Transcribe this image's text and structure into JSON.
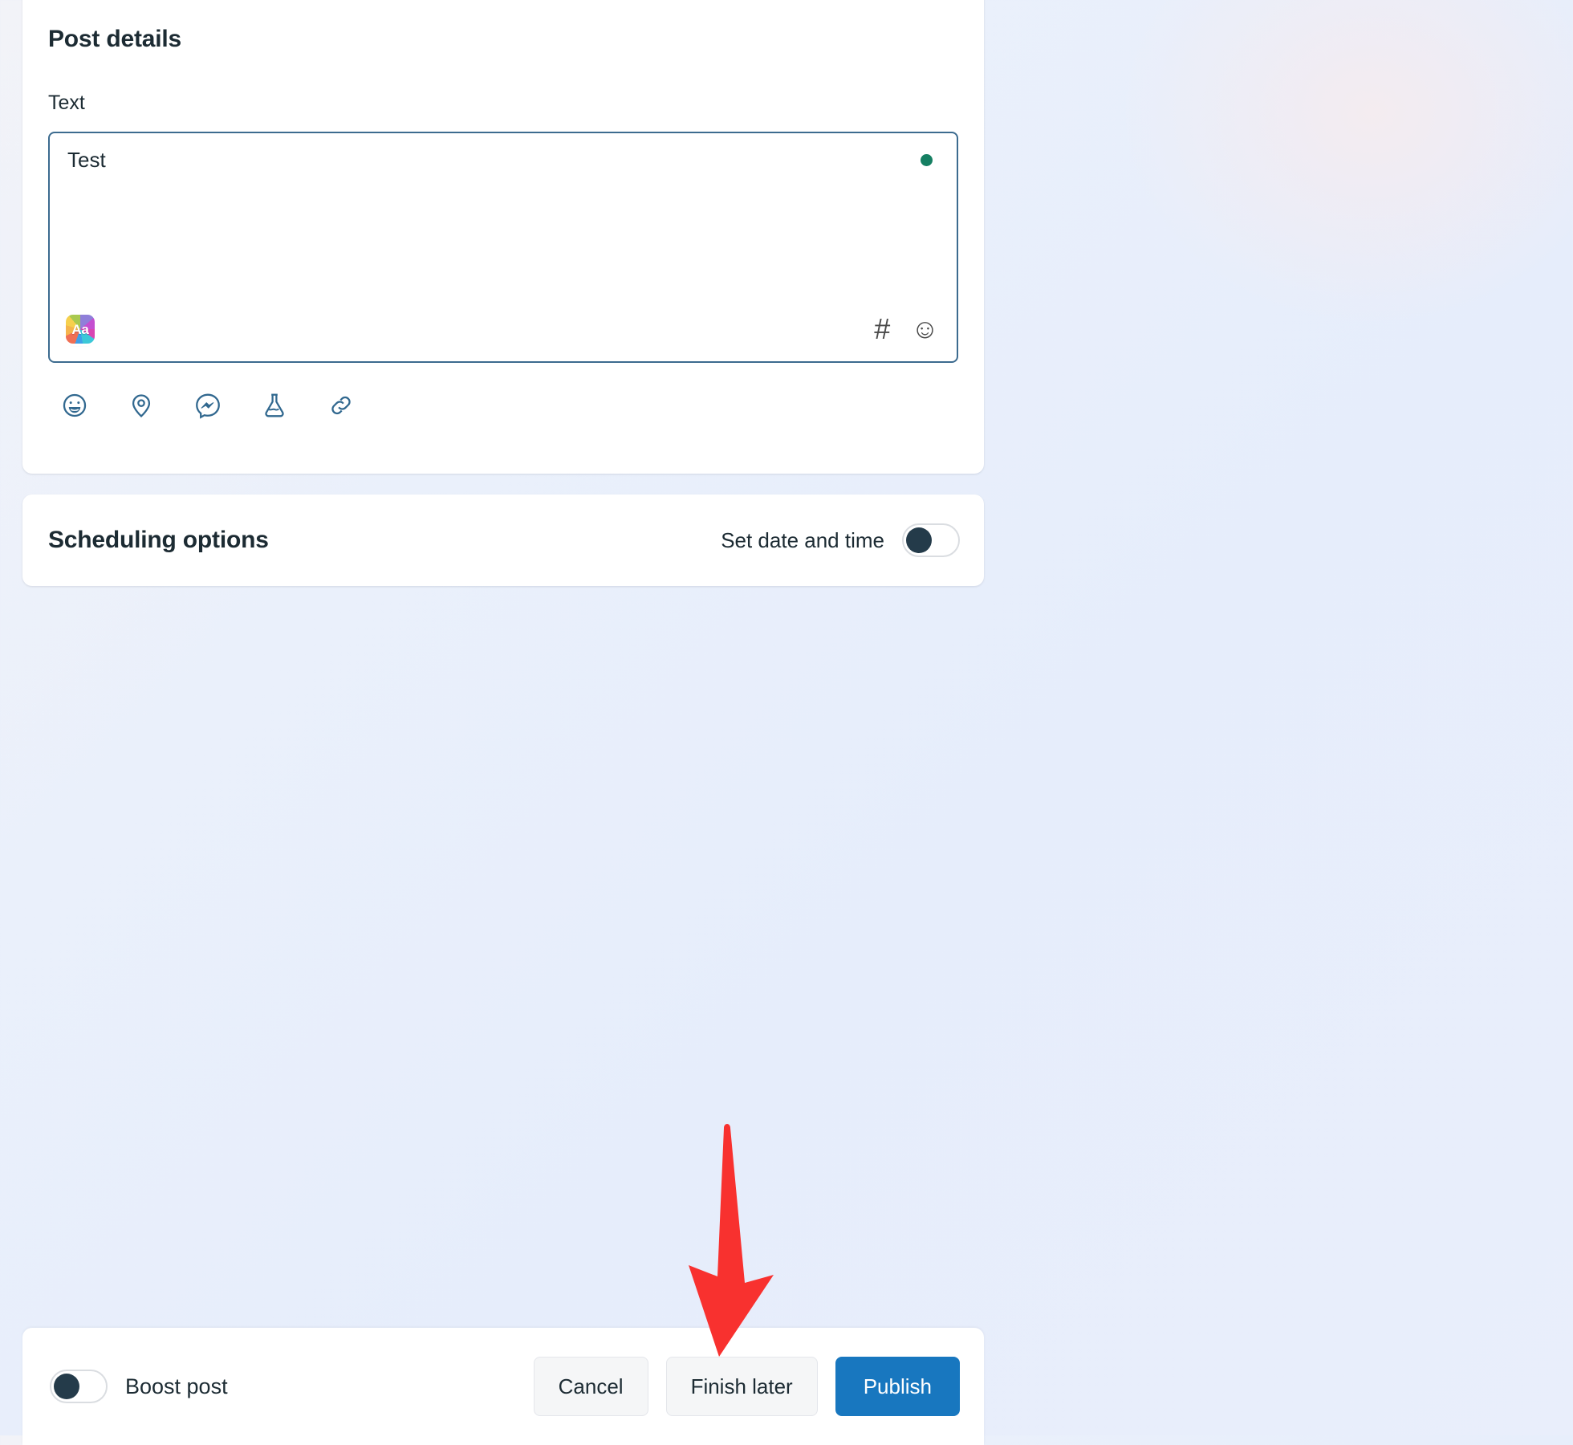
{
  "theme": {
    "accent_blue": "#1877bf",
    "icon_blue": "#31688f",
    "composer_border": "#3c6b8f",
    "status_dot": "#157f62",
    "toggle_knob": "#243b4a",
    "text_dark": "#1c2b33",
    "annotation_red": "#f8312f",
    "page_background": "#e9eefb",
    "secondary_button": "#f5f6f7"
  },
  "post_details": {
    "title": "Post details",
    "text_label": "Text",
    "composer": {
      "value": "Test",
      "placeholder": "",
      "status_dot_label": "saved",
      "font_style_icon": "aa-text-style-icon",
      "font_style_text": "Aa",
      "hashtag_glyph": "#",
      "emoji_glyph": "☺"
    },
    "attachments": [
      {
        "name": "feeling-activity-icon",
        "label": "Feeling/activity"
      },
      {
        "name": "location-pin-icon",
        "label": "Check in"
      },
      {
        "name": "messenger-icon",
        "label": "Messenger"
      },
      {
        "name": "experiment-flask-icon",
        "label": "A/B test"
      },
      {
        "name": "link-icon",
        "label": "Link"
      }
    ]
  },
  "scheduling": {
    "title": "Scheduling options",
    "set_date_time_label": "Set date and time",
    "set_date_time_enabled": false
  },
  "action_bar": {
    "boost_label": "Boost post",
    "boost_enabled": false,
    "cancel_label": "Cancel",
    "finish_later_label": "Finish later",
    "publish_label": "Publish"
  },
  "annotation": {
    "type": "arrow",
    "color": "#f8312f",
    "direction": "down",
    "points_to": "Finish later"
  }
}
